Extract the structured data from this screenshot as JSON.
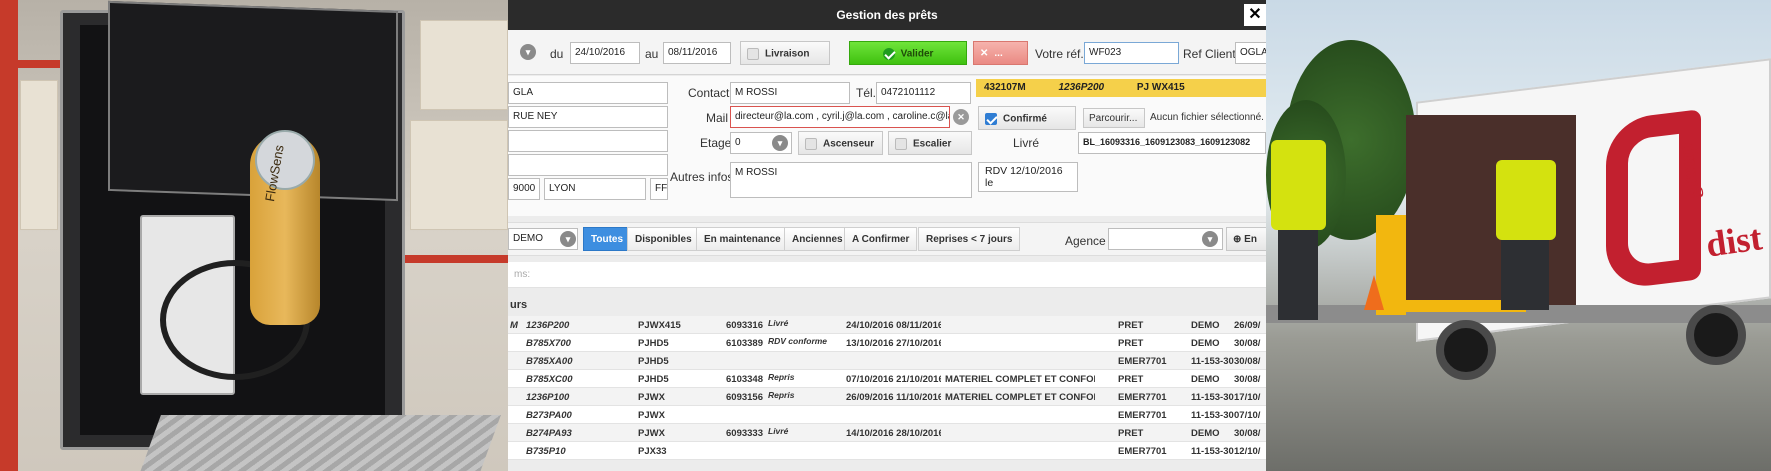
{
  "window": {
    "title": "Gestion des prêts",
    "close": "✕"
  },
  "header": {
    "du_label": "du",
    "date_from": "24/10/2016",
    "au_label": "au",
    "date_to": "08/11/2016",
    "livraison": "Livraison",
    "valider": "Valider",
    "cancel": "...",
    "votre_ref_label": "Votre réf.",
    "votre_ref": "WF023",
    "ref_client_label": "Ref Client",
    "ref_client": "OGLA"
  },
  "form": {
    "client_name": "GLA",
    "address": "RUE NEY",
    "zip": "9000",
    "city": "LYON",
    "country": "FF",
    "contact_label": "Contact",
    "contact": "M ROSSI",
    "tel_label": "Tél.",
    "tel": "0472101112",
    "mail_label": "Mail",
    "mail": "directeur@la.com , cyril.j@la.com , caroline.c@la.com",
    "etage_label": "Etage",
    "etage": "0",
    "ascenseur": "Ascenseur",
    "escalier": "Escalier",
    "autres_label": "Autres infos",
    "autres": "M ROSSI",
    "yellow": {
      "a": "432107M",
      "b": "1236P200",
      "c": "PJ WX415"
    },
    "confirme": "Confirmé",
    "parcourir": "Parcourir...",
    "no_file": "Aucun fichier sélectionné.",
    "livre_label": "Livré",
    "livre_ref": "BL_16093316_1609123083_1609123082",
    "rdv_line1": "RDV 12/10/2016",
    "rdv_line2": "le"
  },
  "filters": {
    "demo": "DEMO",
    "tabs": [
      "Toutes",
      "Disponibles",
      "En maintenance",
      "Anciennes",
      "A Confirmer",
      "Reprises < 7 jours"
    ],
    "agence_label": "Agence",
    "extra": "En"
  },
  "search": {
    "placeholder": "ms:"
  },
  "section": {
    "title": "urs"
  },
  "table": {
    "rows": [
      [
        "M",
        "1236P200",
        "PJWX415",
        "6093316",
        "Livré",
        "24/10/2016 08/11/2016",
        "",
        "PRET",
        "DEMO",
        "26/09/"
      ],
      [
        "",
        "B785X700",
        "PJHD5",
        "6103389",
        "RDV conforme",
        "13/10/2016 27/10/2016",
        "",
        "PRET",
        "DEMO",
        "30/08/"
      ],
      [
        "",
        "B785XA00",
        "PJHD5",
        "",
        "",
        "",
        "",
        "EMER7701",
        "11-153-30",
        "30/08/"
      ],
      [
        "",
        "B785XC00",
        "PJHD5",
        "6103348",
        "Repris",
        "07/10/2016 21/10/2016",
        "MATERIEL COMPLET ET CONFORME",
        "PRET",
        "DEMO",
        "30/08/"
      ],
      [
        "",
        "1236P100",
        "PJWX",
        "6093156",
        "Repris",
        "26/09/2016 11/10/2016",
        "MATERIEL COMPLET ET CONFORME",
        "EMER7701",
        "11-153-30",
        "17/10/"
      ],
      [
        "",
        "B273PA00",
        "PJWX",
        "",
        "",
        "",
        "",
        "EMER7701",
        "11-153-30",
        "07/10/"
      ],
      [
        "",
        "B274PA93",
        "PJWX",
        "6093333",
        "Livré",
        "14/10/2016 28/10/2016",
        "",
        "PRET",
        "DEMO",
        "30/08/"
      ],
      [
        "",
        "B735P10",
        "PJX33",
        "",
        "",
        "",
        "",
        "EMER7701",
        "11-153-30",
        "12/10/"
      ]
    ]
  },
  "photos": {
    "left_brand": "FlowSens",
    "truck_logo": "dist",
    "truck_logo_sub": "group"
  },
  "colors": {
    "accent": "#3d8ee0",
    "valider": "#4fd01c",
    "banner": "#f5d04a",
    "truck_red": "#c2202f"
  }
}
